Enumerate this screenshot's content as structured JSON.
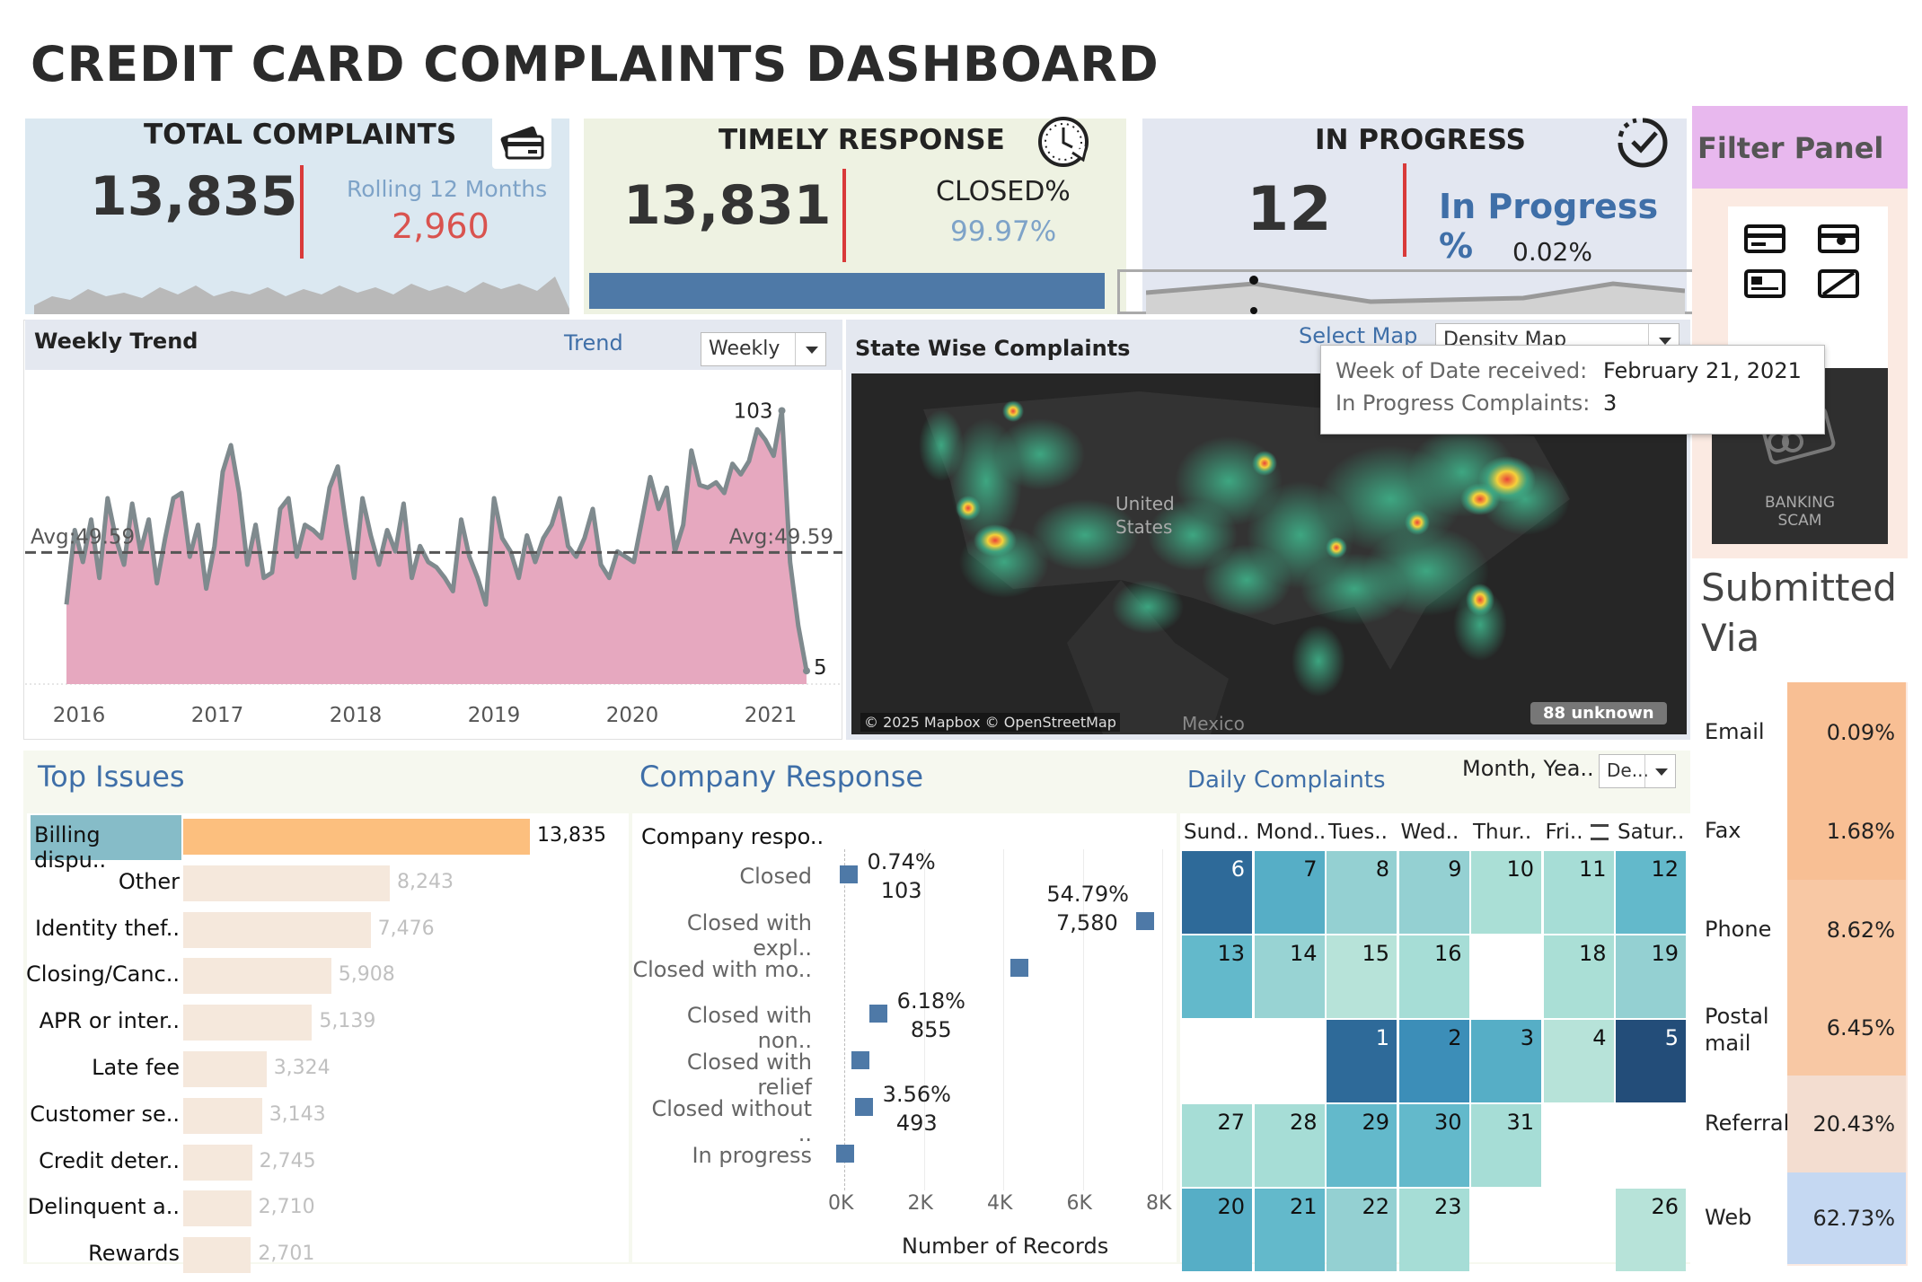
{
  "dashboard": {
    "title": "CREDIT CARD COMPLAINTS DASHBOARD"
  },
  "kpis": {
    "total": {
      "title": "TOTAL COMPLAINTS",
      "value": "13,835",
      "sub_label": "Rolling 12 Months",
      "sub_value": "2,960",
      "icon": "credit-card-icon"
    },
    "timely": {
      "title": "TIMELY RESPONSE",
      "value": "13,831",
      "sub_label": "CLOSED%",
      "sub_value": "99.97%",
      "icon": "clock-check-icon"
    },
    "progress": {
      "title": "IN PROGRESS",
      "value": "12",
      "sub_label": "In Progress %",
      "sub_value": "0.02%",
      "icon": "circle-check-icon"
    }
  },
  "weekly_trend": {
    "title": "Weekly Trend",
    "control_label": "Trend",
    "dropdown_value": "Weekly",
    "avg_left": "Avg:49.59",
    "avg_right": "Avg:49.59",
    "max_label": "103",
    "min_label": "5"
  },
  "map": {
    "title": "State Wise Complaints",
    "control_label": "Select Map",
    "dropdown_value": "Density Map",
    "label_country": "United States",
    "label_mexico": "Mexico",
    "attribution": "© 2025 Mapbox © OpenStreetMap",
    "unknown_badge": "88 unknown"
  },
  "tooltip": {
    "row1_label": "Week of Date received:",
    "row1_value": "February 21, 2021",
    "row2_label": "In Progress Complaints:",
    "row2_value": "3"
  },
  "filter_panel": {
    "title": "Filter Panel",
    "scam_line1": "BANKING",
    "scam_line2": "SCAM",
    "submitted_title_1": "Submitted",
    "submitted_title_2": "Via"
  },
  "submitted_via": [
    {
      "label": "Email",
      "value": "0.09%",
      "color": "#f8bf94"
    },
    {
      "label": "Fax",
      "value": "1.68%",
      "color": "#f8bf94"
    },
    {
      "label": "Phone",
      "value": "8.62%",
      "color": "#f8c8a4"
    },
    {
      "label": "Postal mail",
      "value": "6.45%",
      "color": "#f8c8a4"
    },
    {
      "label": "Referral",
      "value": "20.43%",
      "color": "#f3ddd0"
    },
    {
      "label": "Web",
      "value": "62.73%",
      "color": "#c5d8f2"
    }
  ],
  "company_response": {
    "title": "Company Response",
    "column_header": "Company respo..",
    "x_axis_label": "Number of Records",
    "x_ticks": [
      "0K",
      "2K",
      "4K",
      "6K",
      "8K"
    ]
  },
  "daily_complaints": {
    "title": "Daily Complaints",
    "control_label": "Month, Yea..",
    "dropdown_value": "De...",
    "days": [
      "Sund..",
      "Mond..",
      "Tues..",
      "Wed..",
      "Thur..",
      "Fri..",
      "Satur.."
    ],
    "sort_icon": "sort-icon"
  },
  "top_issues": {
    "title": "Top Issues"
  },
  "chart_data": [
    {
      "type": "area",
      "title": "Weekly Trend",
      "xlabel": "",
      "ylabel": "",
      "x_ticks": [
        "2016",
        "2017",
        "2018",
        "2019",
        "2020",
        "2021"
      ],
      "average": 49.59,
      "max": 103,
      "min": 5,
      "ylim": [
        0,
        115
      ],
      "series": [
        {
          "values": [
            30,
            58,
            46,
            62,
            40,
            70,
            55,
            45,
            68,
            50,
            62,
            38,
            55,
            70,
            72,
            48,
            60,
            36,
            52,
            80,
            90,
            72,
            45,
            60,
            40,
            42,
            66,
            70,
            48,
            60,
            58,
            55,
            74,
            82,
            60,
            40,
            70,
            56,
            45,
            58,
            50,
            68,
            40,
            52,
            46,
            44,
            40,
            35,
            62,
            48,
            40,
            30,
            70,
            55,
            50,
            40,
            56,
            46,
            55,
            60,
            70,
            52,
            48,
            55,
            66,
            45,
            40,
            50,
            48,
            46,
            62,
            78,
            66,
            74,
            50,
            60,
            88,
            75,
            74,
            76,
            72,
            83,
            79,
            84,
            96,
            92,
            86,
            103,
            46,
            22,
            5
          ]
        }
      ]
    },
    {
      "type": "bar",
      "title": "Top Issues",
      "categories": [
        "Billing dispu..",
        "Other",
        "Identity thef..",
        "Closing/Canc..",
        "APR or inter..",
        "Late fee",
        "Customer se..",
        "Credit deter..",
        "Delinquent a..",
        "Rewards"
      ],
      "values": [
        13835,
        8243,
        7476,
        5908,
        5139,
        3324,
        3143,
        2745,
        2710,
        2701
      ],
      "value_labels": [
        "13,835",
        "8,243",
        "7,476",
        "5,908",
        "5,139",
        "3,324",
        "3,143",
        "2,745",
        "2,710",
        "2,701"
      ]
    },
    {
      "type": "scatter",
      "title": "Company Response",
      "xlabel": "Number of Records",
      "xlim": [
        0,
        8000
      ],
      "categories": [
        "Closed",
        "Closed with expl..",
        "Closed with mo..",
        "Closed with non..",
        "Closed with relief",
        "Closed without ..",
        "In progress"
      ],
      "values": [
        103,
        7580,
        4400,
        855,
        400,
        493,
        12
      ],
      "annotations": [
        {
          "index": 0,
          "pct": "0.74%",
          "count": "103"
        },
        {
          "index": 1,
          "pct": "54.79%",
          "count": "7,580"
        },
        {
          "index": 3,
          "pct": "6.18%",
          "count": "855"
        },
        {
          "index": 5,
          "pct": "3.56%",
          "count": "493"
        }
      ]
    },
    {
      "type": "heatmap",
      "title": "Daily Complaints",
      "columns": [
        "Sund..",
        "Mond..",
        "Tues..",
        "Wed..",
        "Thur..",
        "Fri..",
        "Satur.."
      ],
      "rows": [
        [
          6,
          7,
          8,
          9,
          10,
          11,
          12
        ],
        [
          13,
          14,
          15,
          16,
          null,
          18,
          19
        ],
        [
          null,
          null,
          1,
          2,
          3,
          4,
          5
        ],
        [
          27,
          28,
          29,
          30,
          31,
          null,
          null
        ],
        [
          20,
          21,
          22,
          23,
          null,
          null,
          26
        ]
      ],
      "colors": [
        [
          "#2e6a99",
          "#56aec6",
          "#94d0d2",
          "#94d0d2",
          "#aadfd6",
          "#a6ddd6",
          "#63b9cb"
        ],
        [
          "#63b9cb",
          "#98d3d3",
          "#b7e3d9",
          "#a6ddd6",
          null,
          "#aadfd6",
          "#94d0d2"
        ],
        [
          null,
          null,
          "#2e6a99",
          "#3c8eb8",
          "#56aec6",
          "#b7e3d9",
          "#234d79"
        ],
        [
          "#a6ddd6",
          "#a6ddd6",
          "#63b9cb",
          "#63b9cb",
          "#a6ddd6",
          null,
          null
        ],
        [
          "#56aec6",
          "#63b9cb",
          "#94d0d2",
          "#a6ddd6",
          null,
          null,
          "#b7e3d9"
        ]
      ]
    }
  ]
}
